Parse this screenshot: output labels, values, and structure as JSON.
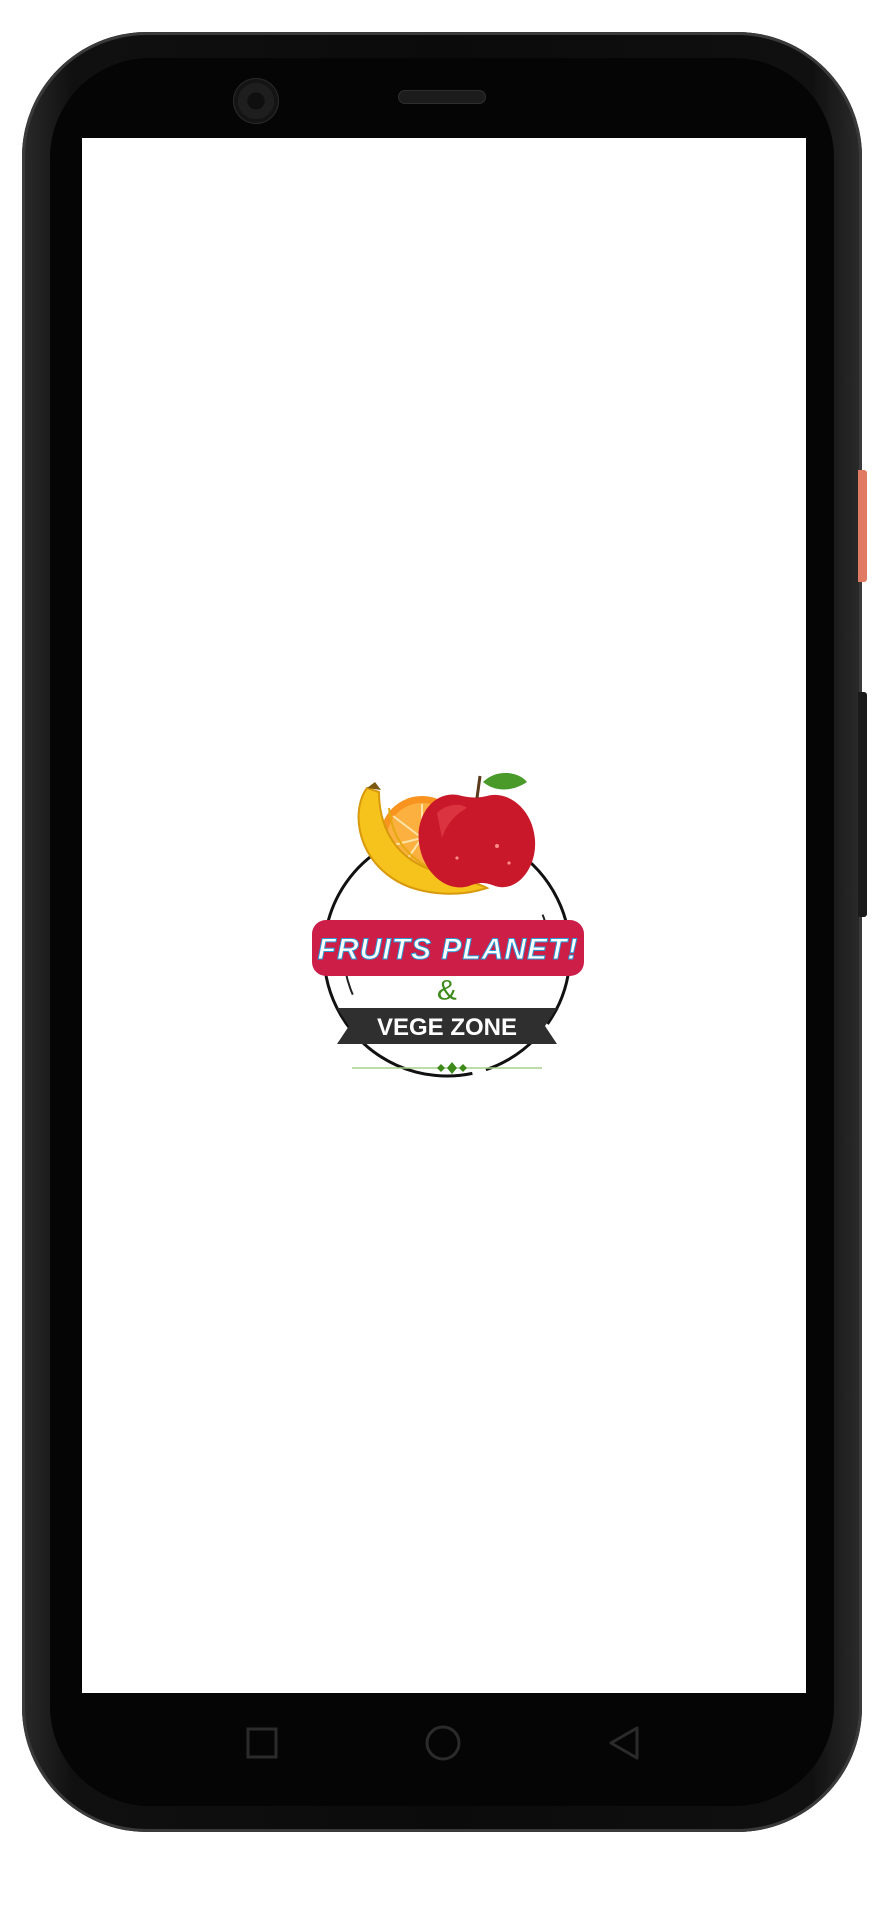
{
  "app": {
    "logo": {
      "line1": "FRUITS PLANET!",
      "ampersand": "&",
      "line2": "VEGE ZONE"
    }
  },
  "colors": {
    "frame": "#0b0b0b",
    "screen_bg": "#ffffff",
    "banner_red": "#cc1e47",
    "ribbon_dark": "#2f2f2f",
    "ampersand_green": "#3d8a1a",
    "volume_button": "#e07a63"
  },
  "nav": {
    "recent_icon": "square-icon",
    "home_icon": "circle-icon",
    "back_icon": "triangle-back-icon"
  }
}
